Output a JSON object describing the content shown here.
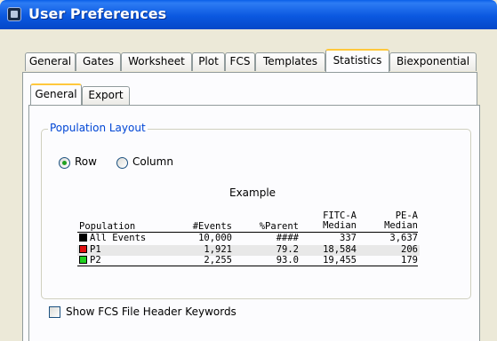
{
  "window": {
    "title": "User Preferences"
  },
  "tabs": [
    "General",
    "Gates",
    "Worksheet",
    "Plot",
    "FCS",
    "Templates",
    "Statistics",
    "Biexponential"
  ],
  "active_tab": "Statistics",
  "subtabs": [
    "General",
    "Export"
  ],
  "active_subtab": "General",
  "population_layout": {
    "legend": "Population Layout",
    "options": [
      "Row",
      "Column"
    ],
    "selected": "Row"
  },
  "example": {
    "title": "Example",
    "headers": {
      "population": "Population",
      "events": "#Events",
      "parent": "%Parent",
      "fitc_line1": "FITC-A",
      "fitc_line2": "Median",
      "pe_line1": "PE-A",
      "pe_line2": "Median"
    },
    "rows": [
      {
        "name": "All Events",
        "swatch": "#000000",
        "events": "10,000",
        "parent": "####",
        "fitc": "337",
        "pe": "3,637"
      },
      {
        "name": "P1",
        "swatch": "#e01010",
        "events": "1,921",
        "parent": "79.2",
        "fitc": "18,584",
        "pe": "206"
      },
      {
        "name": "P2",
        "swatch": "#20d020",
        "events": "2,255",
        "parent": "93.0",
        "fitc": "19,455",
        "pe": "179"
      }
    ]
  },
  "show_fcs_header": {
    "label": "Show FCS File Header Keywords",
    "checked": false
  }
}
